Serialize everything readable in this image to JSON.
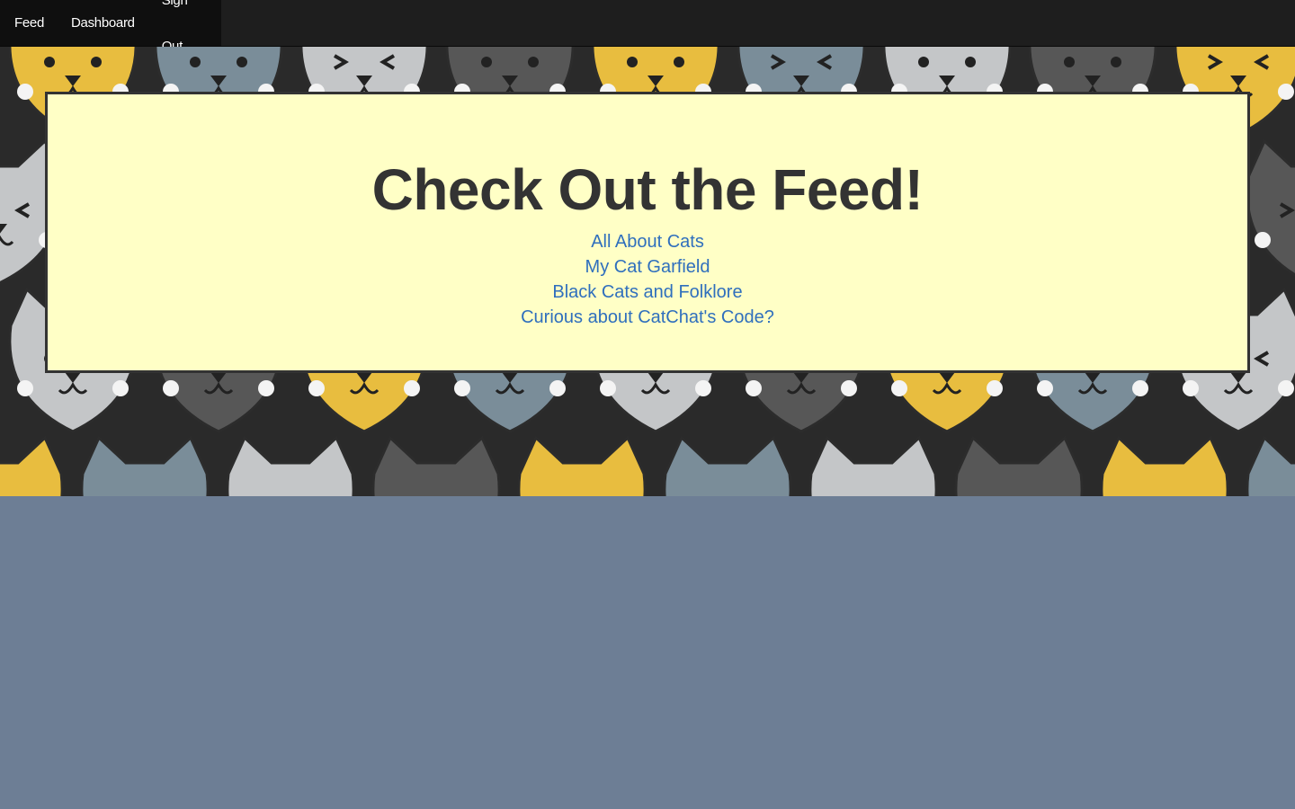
{
  "nav": {
    "items": [
      {
        "label": "Feed"
      },
      {
        "label": "Dashboard"
      },
      {
        "label": "Sign Out"
      }
    ]
  },
  "feed": {
    "title": "Check Out the Feed!",
    "links": [
      {
        "label": "All About Cats"
      },
      {
        "label": "My Cat Garfield"
      },
      {
        "label": "Black Cats and Folklore"
      },
      {
        "label": "Curious about CatChat's Code?"
      }
    ]
  },
  "banner": {
    "pattern": "cat-faces-pattern",
    "palette": [
      "#e8bd3f",
      "#c4c6c8",
      "#7a8d99",
      "#575757",
      "#333333"
    ]
  },
  "colors": {
    "navbar": "#1e1e1e",
    "card_background": "#ffffc6",
    "link": "#2f6fbd",
    "page_background": "#6d7e95"
  }
}
